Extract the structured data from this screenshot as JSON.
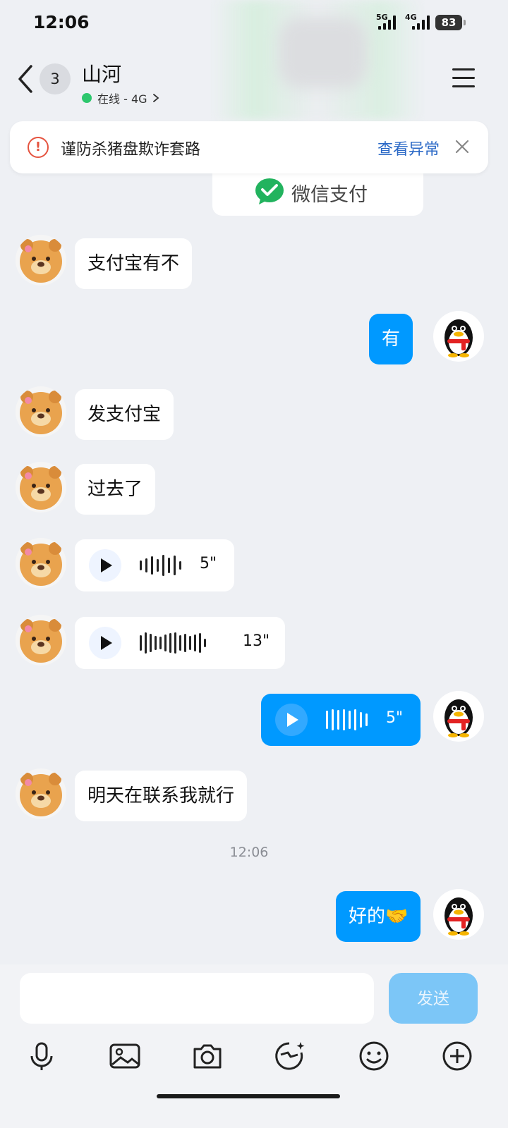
{
  "status_bar": {
    "time": "12:06",
    "net1": "5G",
    "net2": "4G",
    "battery": "83"
  },
  "header": {
    "unread_count": "3",
    "title": "山河",
    "status": "在线 - 4G"
  },
  "warning": {
    "text": "谨防杀猪盘欺诈套路",
    "link": "查看异常"
  },
  "wechat_card": {
    "label": "微信支付"
  },
  "messages": [
    {
      "side": "in",
      "text": "支付宝有不"
    },
    {
      "side": "out",
      "text": "有"
    },
    {
      "side": "in",
      "text": "发支付宝"
    },
    {
      "side": "in",
      "text": "过去了"
    },
    {
      "side": "in",
      "voice": true,
      "duration": "5\""
    },
    {
      "side": "in",
      "voice": true,
      "duration": "13\""
    },
    {
      "side": "out",
      "voice": true,
      "duration": "5\""
    },
    {
      "side": "in",
      "text": "明天在联系我就行"
    },
    {
      "side": "out",
      "text": "好的🤝"
    }
  ],
  "timestamp": "12:06",
  "composer": {
    "input_value": "",
    "send_label": "发送"
  },
  "colors": {
    "accent": "#0099ff",
    "warning": "#e5533f",
    "link": "#2a68c6",
    "online": "#2dc76d"
  }
}
